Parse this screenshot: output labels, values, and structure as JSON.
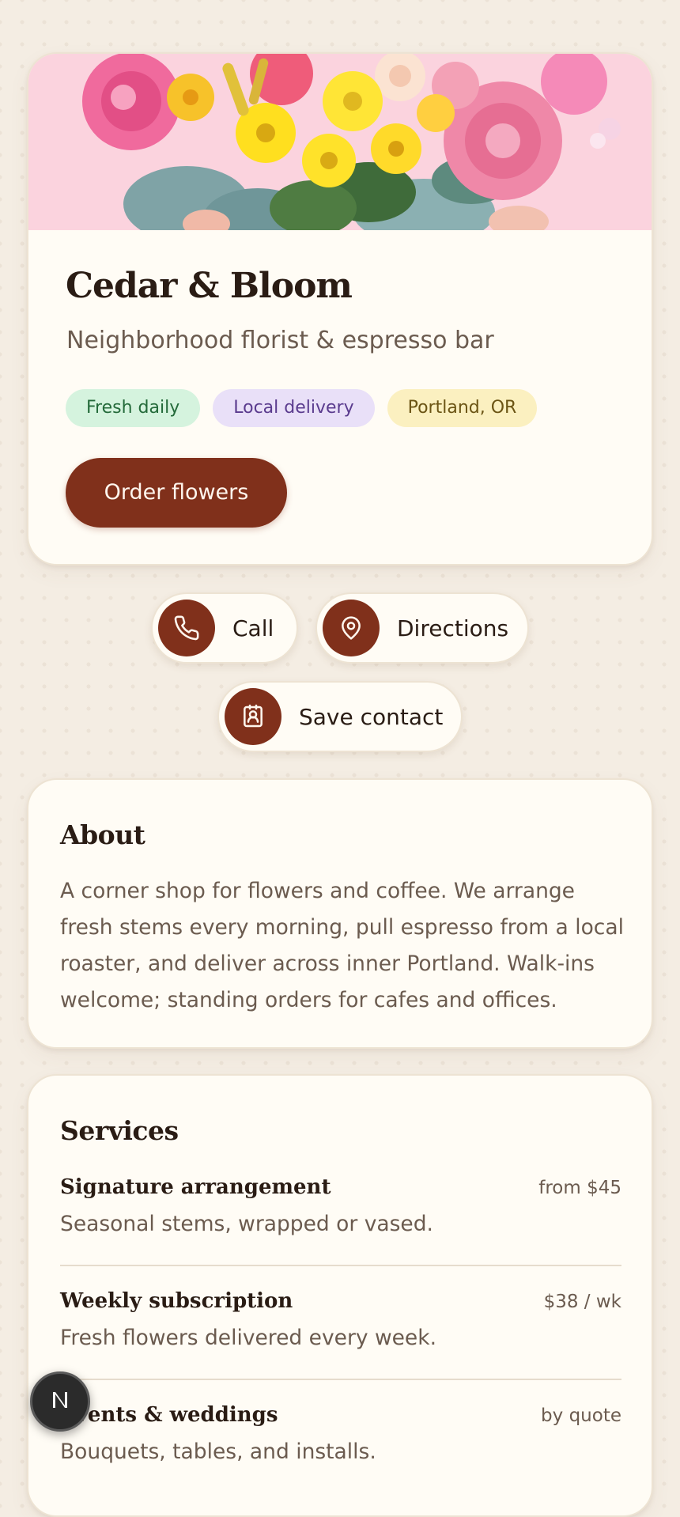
{
  "business": {
    "name": "Cedar & Bloom",
    "tagline": "Neighborhood florist & espresso bar",
    "chips": [
      "Fresh daily",
      "Local delivery",
      "Portland, OR"
    ],
    "cta_label": "Order flowers"
  },
  "actions": {
    "call_label": "Call",
    "directions_label": "Directions",
    "save_label": "Save contact",
    "call_icon": "phone-icon",
    "directions_icon": "map-pin-icon",
    "save_icon": "contact-card-icon"
  },
  "about": {
    "title": "About",
    "text": "A corner shop for flowers and coffee. We arrange fresh stems every morning, pull espresso from a local roaster, and deliver across inner Portland. Walk-ins welcome; standing orders for cafes and offices."
  },
  "services": {
    "title": "Services",
    "items": [
      {
        "name": "Signature arrangement",
        "price": "from $45",
        "desc": "Seasonal stems, wrapped or vased."
      },
      {
        "name": "Weekly subscription",
        "price": "$38 / wk",
        "desc": "Fresh flowers delivered every week."
      },
      {
        "name": "Events & weddings",
        "price": "by quote",
        "desc": "Bouquets, tables, and installs."
      }
    ]
  },
  "fab": {
    "label": "N",
    "icon": "n-logo-icon"
  },
  "colors": {
    "accent": "#80301b",
    "page_bg": "#f4ede3",
    "card_bg": "#fffcf5",
    "chip_green": "#d5f3de",
    "chip_purple": "#e9e0f8",
    "chip_yellow": "#fbf0c0"
  }
}
